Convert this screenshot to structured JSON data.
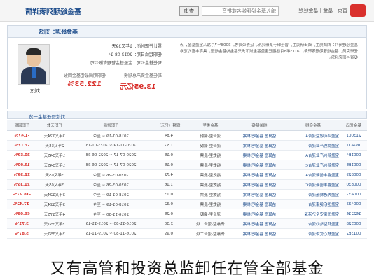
{
  "header": {
    "search_placeholder": "输入基金经理姓名或拼音",
    "search_button": "查询",
    "nav_links": [
      "首页",
      "基金",
      "基金经理"
    ],
    "page_title": "基金经理列表详情"
  },
  "manager": {
    "panel_title": "基金经理：刘炫",
    "name": "刘炫",
    "info_lines": [
      "累计任职时间：1年又39天",
      "任职起始日期：2013-08-14",
      "现任基金公司：宝盈基金管理有限公司"
    ],
    "stats": [
      {
        "label": "现任基金资产总规模",
        "value": "13.95亿元"
      },
      {
        "label": "任职期间最佳基金回报",
        "value": "122.53%"
      }
    ],
    "bio": "基金经理简介：刘炫先生，硕士研究生，曾任职于某研究所、证券公司等。2008年7月加入宝盈基金，历任研究员、基金经理助理等职务。2013年8月起担任宝盈基金旗下多只基金的基金经理，具有丰富的证券投资与研究经验。"
  },
  "table": {
    "section_title": "刘炫现任基金一览",
    "columns": [
      "基金代码",
      "基金名称",
      "相关链接",
      "基金类型",
      "规模（亿元）",
      "任职时间",
      "任职天数",
      "任职回报"
    ],
    "rows": [
      [
        "213001",
        "宝盈鸿利收益混合A",
        "估算图 基金吧 档案",
        "混合型-偏股",
        "4.84",
        "2018-01-19 ~ 至今",
        "3年又124天",
        "-1.47%"
      ],
      [
        "162411",
        "宝盈优势产业混合",
        "估算图 基金吧 档案",
        "混合型-偏股",
        "1.52",
        "2020-11-19 ~ 2023-01-13",
        "2年又55天",
        "-2.12%"
      ],
      [
        "000184",
        "宝盈新兴产业混合A",
        "估算图 基金吧 档案",
        "指数型-股票",
        "0.15",
        "2020-07-17 ~ 2022-06-28",
        "1年又345天",
        "20.59%"
      ],
      [
        "000185",
        "宝盈新兴产业混合C",
        "估算图 基金吧 档案",
        "指数型-股票",
        "0.15",
        "2020-07-17 ~ 2022-06-28",
        "1年又345天",
        "19.90%"
      ],
      [
        "000829",
        "宝盈睿丰创新混合A",
        "估算图 基金吧 档案",
        "指数型-股票",
        "4.72",
        "2020-03-26 ~ 至今",
        "3年又65天",
        "22.59%"
      ],
      [
        "000830",
        "宝盈睿丰创新混合C",
        "估算图 基金吧 档案",
        "指数型-股票",
        "1.16",
        "2020-03-26 ~ 至今",
        "3年又65天",
        "21.35%"
      ],
      [
        "000432",
        "宝盈先进制造混合",
        "估算图 基金吧 档案",
        "指数型-股票",
        "0.13",
        "2018-01-19 ~ 至今",
        "3年又124天",
        "-18.27%"
      ],
      [
        "000433",
        "宝盈医疗健康混合",
        "估算图 基金吧 档案",
        "指数型-股票",
        "0.32",
        "2018-01-19 ~ 至今",
        "3年又124天",
        "-17.42%"
      ],
      [
        "162216",
        "宝盈国家安全沪港深",
        "估算图 基金吧 档案",
        "混合型-偏股",
        "0.25",
        "2016-11-30 ~ 至今",
        "4年又175天",
        "66.03%"
      ],
      [
        "000528",
        "宝盈转型动力混合",
        "估算图 基金吧 档案",
        "债券型-混合二级",
        "2.30",
        "2016-11-30 ~ 2019-11-15",
        "2年又351天",
        "3.71%"
      ],
      [
        "001382",
        "宝盈核心优势混合",
        "估算图 基金吧 档案",
        "债券型-混合二级",
        "0.99",
        "2016-11-30 ~ 2019-11-15",
        "2年又351天",
        "5.87%"
      ]
    ]
  },
  "caption": "又有高管和投资总监卸任在管全部基金"
}
